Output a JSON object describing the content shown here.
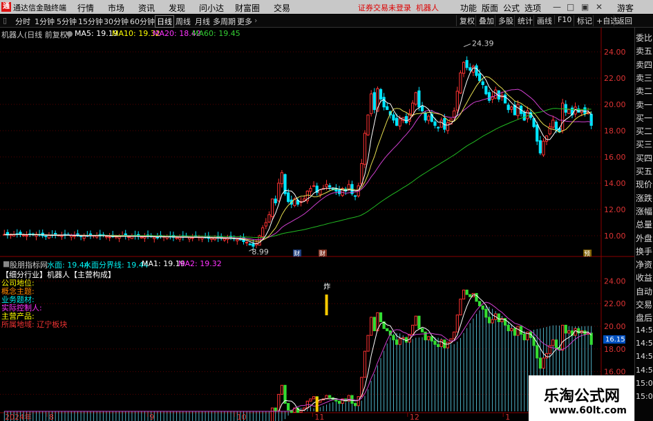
{
  "app": {
    "title": "通达信金融终端",
    "logo": "通",
    "warning": "证券交易未登录",
    "user": "机器人"
  },
  "menu": [
    "行情",
    "市场",
    "资讯",
    "发现",
    "问小达",
    "财富圈",
    "交易"
  ],
  "menu_right": [
    "功能",
    "版面",
    "公式",
    "选项",
    "游客"
  ],
  "toolbar": {
    "periods": [
      "分时",
      "1分钟",
      "5分钟",
      "15分钟",
      "30分钟",
      "60分钟",
      "日线",
      "周线",
      "月线",
      "多周期",
      "更多"
    ],
    "selected": "日线",
    "right": [
      "复权",
      "叠加",
      "多股",
      "统计",
      "画线",
      "F10",
      "标记",
      "+自选",
      "返回"
    ]
  },
  "main_header": {
    "name": "机器人(日线 前复权)",
    "ma5": "MA5: 19.19",
    "ma10": "MA10: 19.32",
    "ma20": "MA20: 18.42",
    "ma60": "MA60: 19.45"
  },
  "sub_header": {
    "name": "股朋指标网",
    "water": "水面: 19.44",
    "water_line": "水面分界线: 19.44",
    "ma1": "MA1: 19.19",
    "ma2": "MA2: 19.32"
  },
  "indicator_text": {
    "line1": "【细分行业】机器人【主营构成】",
    "line2": "公司地位:",
    "line3": "概念主题:",
    "line4": "业务题材:",
    "line5": "实际控制人:",
    "line6": "主营产品:",
    "line7": "所属地域: 辽宁板块"
  },
  "sidebar": [
    "委比",
    "卖五",
    "卖四",
    "卖三",
    "卖二",
    "卖一",
    "买一",
    "买二",
    "买三",
    "买四",
    "买五",
    "现价",
    "涨跌",
    "涨幅",
    "总量",
    "外盘",
    "换手",
    "净资",
    "收益",
    "自动",
    "交易",
    "盘后",
    "14:56",
    "14:56",
    "14:56",
    "14:57",
    "15:00",
    "15:00"
  ],
  "markers": {
    "high": "24.39",
    "low": "8.99",
    "price_tag": "16.15",
    "cai1": "财",
    "cai2": "财",
    "biao": "预",
    "zha": "炸"
  },
  "watermark": {
    "line1": "乐淘公式网",
    "line2": "www.60lt.com"
  },
  "chart_data": {
    "type": "candlestick",
    "x_labels": [
      "2024年",
      "8",
      "9",
      "10",
      "11",
      "12",
      "1"
    ],
    "y_ticks_main": [
      24.0,
      22.0,
      20.0,
      18.0,
      16.0,
      14.0,
      12.0,
      10.0
    ],
    "y_ticks_sub": [
      24.0,
      22.0,
      20.0,
      18.0,
      16.0,
      14.0
    ],
    "ylim_main": [
      9.0,
      25.0
    ],
    "ylim_sub": [
      12.5,
      25.0
    ],
    "close": [
      10.1,
      10.05,
      10.12,
      10.08,
      10.15,
      10.1,
      10.05,
      10.02,
      10.08,
      10.1,
      10.12,
      10.05,
      10.0,
      9.98,
      10.02,
      10.05,
      10.08,
      10.04,
      10.0,
      10.02,
      10.05,
      10.03,
      10.0,
      9.98,
      9.95,
      9.98,
      10.0,
      10.05,
      10.02,
      10.0,
      9.98,
      10.02,
      9.95,
      9.9,
      9.92,
      9.95,
      9.98,
      10.0,
      9.96,
      9.92,
      9.95,
      9.98,
      9.94,
      9.9,
      9.92,
      9.96,
      9.93,
      9.9,
      9.88,
      9.92,
      9.95,
      9.93,
      9.9,
      9.88,
      9.85,
      9.88,
      9.92,
      9.9,
      9.87,
      9.85,
      9.88,
      9.9,
      9.86,
      9.84,
      9.8,
      9.82,
      9.85,
      9.82,
      9.8,
      9.78,
      9.82,
      9.8,
      9.76,
      9.72,
      9.7,
      9.55,
      9.5,
      9.3,
      9.2,
      9.4,
      10.0,
      10.6,
      11.0,
      11.6,
      12.8,
      12.5,
      14.0,
      14.8,
      13.2,
      12.6,
      12.4,
      12.8,
      12.4,
      12.6,
      12.8,
      13.4,
      13.6,
      13.8,
      13.3,
      13.5,
      13.6,
      13.9,
      13.7,
      13.5,
      13.4,
      13.2,
      13.6,
      13.4,
      13.9,
      13.2,
      13.0,
      13.8,
      15.5,
      17.8,
      19.2,
      20.8,
      19.6,
      21.2,
      20.4,
      19.8,
      19.6,
      19.2,
      18.8,
      18.4,
      18.9,
      19.0,
      18.6,
      19.3,
      20.1,
      20.9,
      19.8,
      19.5,
      18.8,
      19.1,
      18.7,
      18.4,
      18.2,
      18.8,
      18.1,
      18.6,
      18.9,
      19.5,
      21.0,
      22.4,
      23.2,
      22.8,
      22.6,
      22.9,
      22.2,
      21.8,
      21.5,
      20.8,
      20.3,
      20.6,
      21.1,
      20.4,
      20.7,
      20.1,
      19.6,
      19.8,
      19.2,
      20.0,
      19.3,
      18.8,
      19.5,
      19.0,
      18.3,
      17.2,
      16.3,
      17.2,
      17.6,
      18.3,
      18.8,
      18.1,
      17.9,
      20.1,
      19.4,
      19.6,
      19.2,
      19.8,
      19.4,
      19.6,
      19.3,
      19.4,
      18.4
    ],
    "note": "approximate daily closes read from chart"
  }
}
